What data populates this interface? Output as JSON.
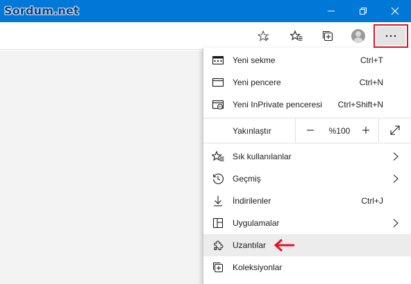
{
  "brand": "Sordum.net",
  "menu": {
    "items": [
      {
        "label": "Yeni sekme",
        "shortcut": "Ctrl+T"
      },
      {
        "label": "Yeni pencere",
        "shortcut": "Ctrl+N"
      },
      {
        "label": "Yeni InPrivate penceresi",
        "shortcut": "Ctrl+Shift+N"
      }
    ],
    "zoom": {
      "label": "Yakınlaştır",
      "value": "%100",
      "minus": "−",
      "plus": "+"
    },
    "items2": [
      {
        "label": "Sık kullanılanlar"
      },
      {
        "label": "Geçmiş"
      },
      {
        "label": "İndirilenler",
        "shortcut": "Ctrl+J"
      },
      {
        "label": "Uygulamalar"
      },
      {
        "label": "Uzantılar"
      },
      {
        "label": "Koleksiyonlar"
      }
    ]
  },
  "colors": {
    "titlebar": "#0078d7",
    "highlight_box": "#e81123",
    "arrow": "#e81123"
  }
}
